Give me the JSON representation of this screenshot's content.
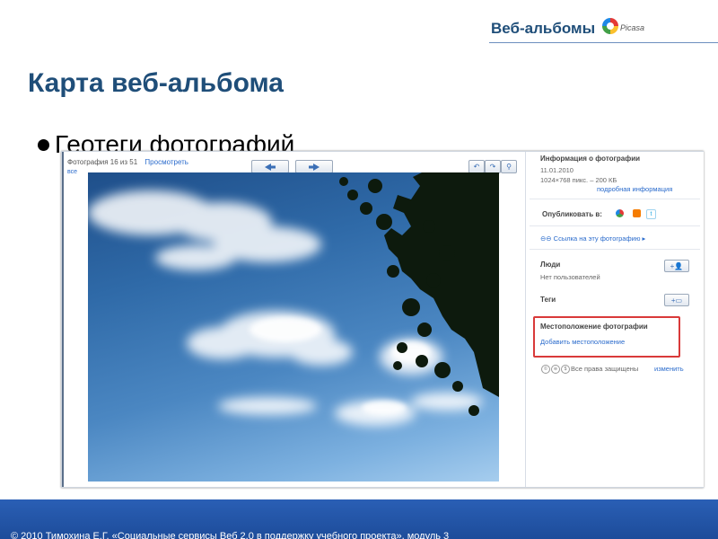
{
  "header": {
    "section_title": "Веб-альбомы",
    "picasa_logo_text": "Picasa"
  },
  "slide": {
    "title": "Карта веб-альбома",
    "bullet": "Геотеги фотографий"
  },
  "screenshot": {
    "photo_counter": "Фотография 16 из 51",
    "view_link": "Просмотреть",
    "all_link": "все",
    "nav": {
      "prev_icon": "arrow-left-icon",
      "next_icon": "arrow-right-icon"
    },
    "tools": [
      "rotate-left-icon",
      "rotate-right-icon",
      "zoom-icon"
    ],
    "sidebar": {
      "info_heading": "Информация о фотографии",
      "date": "11.01.2010",
      "dimensions": "1024×768 пикс. – 200 КБ",
      "details_link": "подробная информация",
      "publish_label": "Опубликовать в:",
      "share_services": [
        "google-buzz-icon",
        "blogger-icon",
        "twitter-icon"
      ],
      "photo_link": "Ссылка на эту фотографию",
      "people_heading": "Люди",
      "people_empty": "Нет пользователей",
      "tags_heading": "Теги",
      "location_heading": "Местоположение фотографии",
      "add_location_link": "Добавить местоположение",
      "rights_text": "Все права защищены",
      "change_link": "изменить"
    }
  },
  "footer": {
    "text": "© 2010 Тимохина Е.Г. «Социальные сервисы Веб 2.0 в поддержку учебного проекта», модуль 3"
  },
  "colors": {
    "title_blue": "#1f4e79",
    "footer_blue": "#2a5fb5",
    "link_blue": "#2a6bcc",
    "highlight_red": "#d93a3a"
  }
}
